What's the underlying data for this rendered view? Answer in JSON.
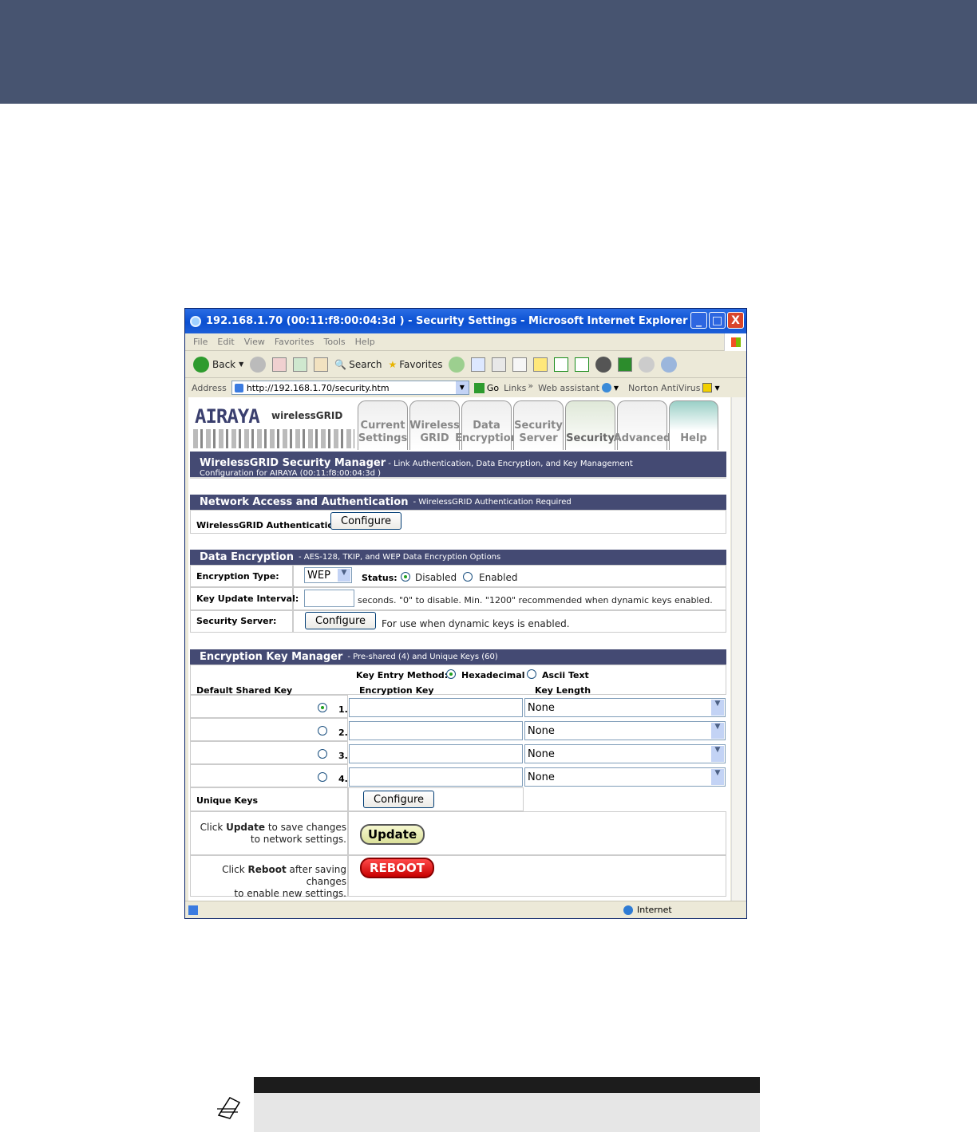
{
  "window": {
    "title": "192.168.1.70 (00:11:f8:00:04:3d ) - Security Settings - Microsoft Internet Explorer",
    "buttons": [
      "_",
      "□",
      "X"
    ]
  },
  "menu": [
    "File",
    "Edit",
    "View",
    "Favorites",
    "Tools",
    "Help"
  ],
  "toolbar": {
    "back": "Back",
    "search": "Search",
    "favorites": "Favorites"
  },
  "address": {
    "label": "Address",
    "url": "http://192.168.1.70/security.htm",
    "go": "Go",
    "links": "Links",
    "links_more": "»",
    "web_assistant": "Web assistant",
    "norton": "Norton AntiVirus"
  },
  "brand": {
    "logo": "AIRAYA",
    "product": "wirelessGRID"
  },
  "tabs": [
    {
      "line1": "Current",
      "line2": "Settings"
    },
    {
      "line1": "Wireless",
      "line2": "GRID"
    },
    {
      "line1": "Data",
      "line2": "Encryption"
    },
    {
      "line1": "Security",
      "line2": "Server"
    },
    {
      "line1": "",
      "line2": "Security"
    },
    {
      "line1": "",
      "line2": "Advanced"
    },
    {
      "line1": "",
      "line2": "Help"
    }
  ],
  "page_title": {
    "main": "WirelessGRID Security Manager",
    "desc": " - Link Authentication, Data Encryption, and Key Management",
    "config": "Configuration for AIRAYA (00:11:f8:00:04:3d )"
  },
  "network_access": {
    "title": "Network Access and Authentication",
    "subtitle": " - WirelessGRID Authentication Required",
    "auth_label": "WirelessGRID Authentication:",
    "configure": "Configure"
  },
  "data_encryption": {
    "title": "Data Encryption",
    "subtitle": " - AES-128, TKIP, and WEP Data Encryption Options",
    "type_label": "Encryption Type:",
    "type_value": "WEP",
    "status_label": "Status:",
    "disabled": "Disabled",
    "enabled": "Enabled",
    "interval_label": "Key Update Interval:",
    "interval_hint": "seconds. \"0\" to disable. Min. \"1200\" recommended when dynamic keys enabled.",
    "server_label": "Security Server:",
    "configure": "Configure",
    "server_hint": "For use when dynamic keys is enabled."
  },
  "key_manager": {
    "title": "Encryption Key Manager",
    "subtitle": " - Pre-shared (4) and Unique Keys (60)",
    "entry_method_label": "Key Entry Method:",
    "hex": "Hexadecimal",
    "ascii": "Ascii Text",
    "col_default": "Default Shared Key",
    "col_key": "Encryption Key",
    "col_length": "Key Length",
    "rows": [
      {
        "num": "1.",
        "length": "None",
        "selected": true
      },
      {
        "num": "2.",
        "length": "None",
        "selected": false
      },
      {
        "num": "3.",
        "length": "None",
        "selected": false
      },
      {
        "num": "4.",
        "length": "None",
        "selected": false
      }
    ],
    "unique_label": "Unique Keys",
    "configure": "Configure"
  },
  "actions": {
    "update_pre": "Click ",
    "update_bold": "Update",
    "update_post": " to save changes",
    "update_line2": "to network settings.",
    "update_btn": "Update",
    "reboot_pre": "Click ",
    "reboot_bold": "Reboot",
    "reboot_post": " after saving changes",
    "reboot_line2": "to enable new settings.",
    "reboot_btn": "REBOOT"
  },
  "status": {
    "zone": "Internet"
  }
}
